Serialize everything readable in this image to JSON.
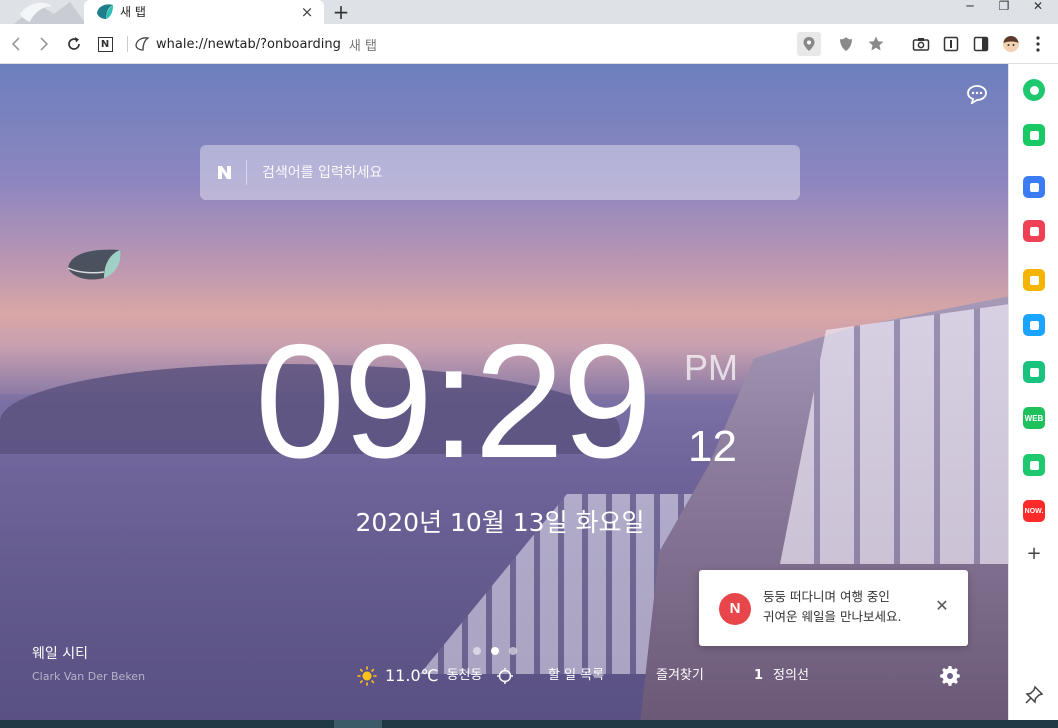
{
  "tab": {
    "title": "새 탭",
    "close": "×"
  },
  "new_tab": "+",
  "window": {
    "minimize": "─",
    "maximize": "❐",
    "close": "✕"
  },
  "address": {
    "url": "whale://newtab/?onboarding",
    "page_title": "새 탭"
  },
  "search": {
    "placeholder": "검색어를 입력하세요"
  },
  "clock": {
    "time": "09:29",
    "ampm": "PM",
    "seconds": "12"
  },
  "date": {
    "text": "2020년 10월 13일 화요일"
  },
  "photo": {
    "title": "웨일 시티",
    "author": "Clark Van Der Beken"
  },
  "weather": {
    "temperature": "11.0℃",
    "location": "동천동"
  },
  "bottom": {
    "todo": "할 일 목록",
    "favorites": "즐겨찾기",
    "user_number": "1",
    "user_name": "정의선"
  },
  "toast": {
    "badge": "N",
    "line1": "둥둥 떠다니며 여행 중인",
    "line2": "귀여운 웨일을 만나보세요.",
    "close": "✕"
  },
  "sidebar": {
    "items": [
      {
        "name": "green-circle-app-icon",
        "color": "#1ec86e",
        "label": ""
      },
      {
        "name": "bell-app-icon",
        "color": "#18c964",
        "label": ""
      },
      {
        "name": "briefcase-app-icon",
        "color": "#3b7cf5",
        "label": ""
      },
      {
        "name": "pocket-app-icon",
        "color": "#ef4056",
        "label": ""
      },
      {
        "name": "star-app-icon",
        "color": "#f5b400",
        "label": ""
      },
      {
        "name": "papago-app-icon",
        "color": "#1aa3ff",
        "label": ""
      },
      {
        "name": "play-app-icon",
        "color": "#19c37d",
        "label": ""
      },
      {
        "name": "webtoon-app-icon",
        "color": "#1fc15c",
        "label": "WEB"
      },
      {
        "name": "green-square-app-icon",
        "color": "#1ec86e",
        "label": ""
      },
      {
        "name": "now-app-icon",
        "color": "#ff2a2a",
        "label": "NOW."
      }
    ],
    "add": "+"
  },
  "colors": {
    "accent": "#1ec86e",
    "toast_badge": "#e8464a",
    "taskbar": "#1f3a45"
  }
}
